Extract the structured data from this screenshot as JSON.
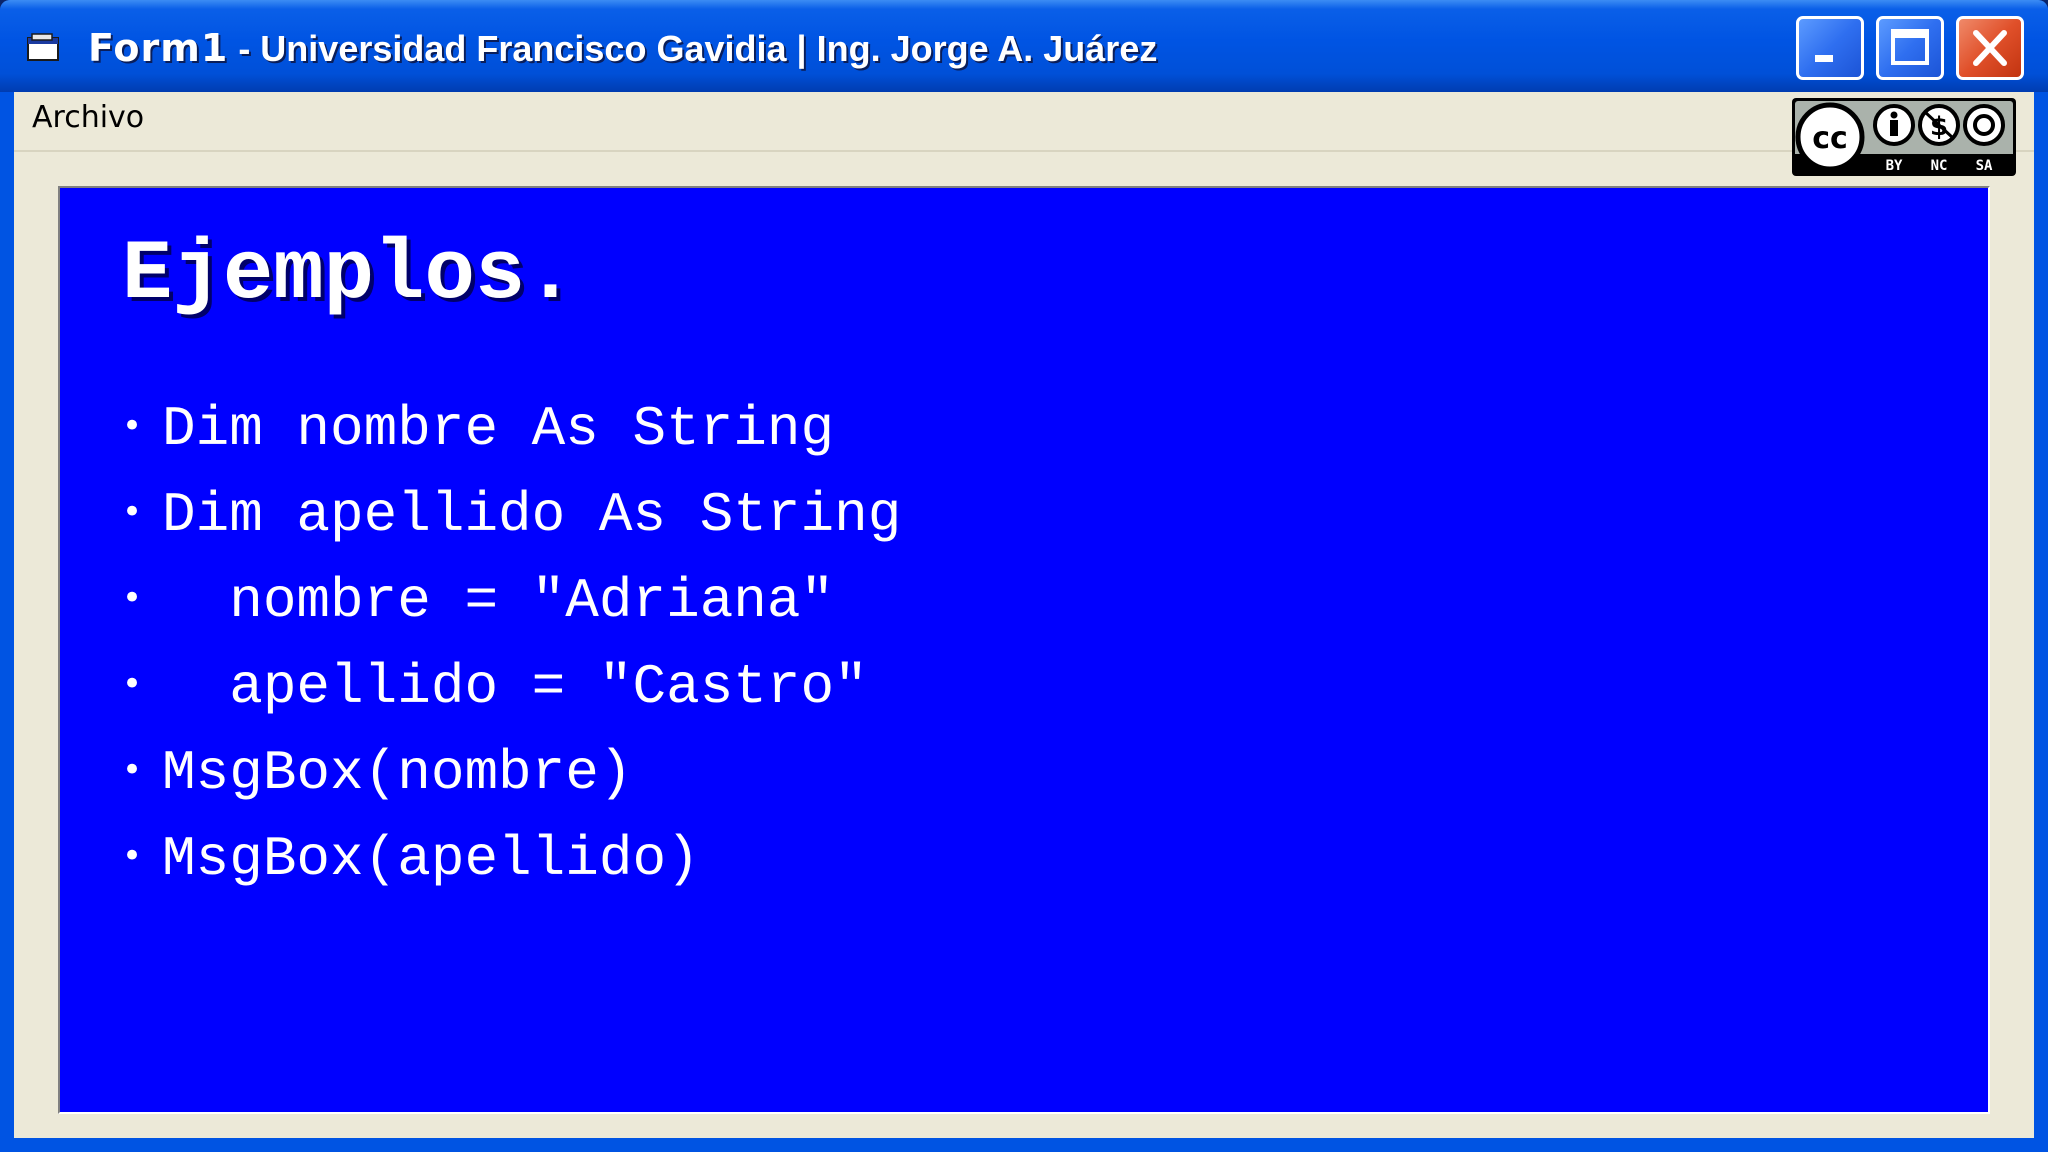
{
  "window": {
    "title_form": "Form1",
    "title_rest": " - Universidad Francisco Gavidia | Ing. Jorge A. Juárez"
  },
  "menu": {
    "items": [
      {
        "label": "Archivo"
      }
    ]
  },
  "license_badge": {
    "icon": "creative-commons-by-nc-sa",
    "labels": [
      "BY",
      "NC",
      "SA"
    ]
  },
  "slide": {
    "title": "Ejemplos.",
    "bullets": [
      {
        "text": "Dim nombre As String"
      },
      {
        "text": "  nombre = \"Adriana\""
      },
      {
        "text": "Dim apellido As String"
      },
      {
        "text": "  apellido = \"Castro\""
      },
      {
        "text": "MsgBox(nombre)"
      },
      {
        "text": "MsgBox(apellido)"
      }
    ],
    "background_color": "#0000ff",
    "text_color": "#ffffff"
  }
}
